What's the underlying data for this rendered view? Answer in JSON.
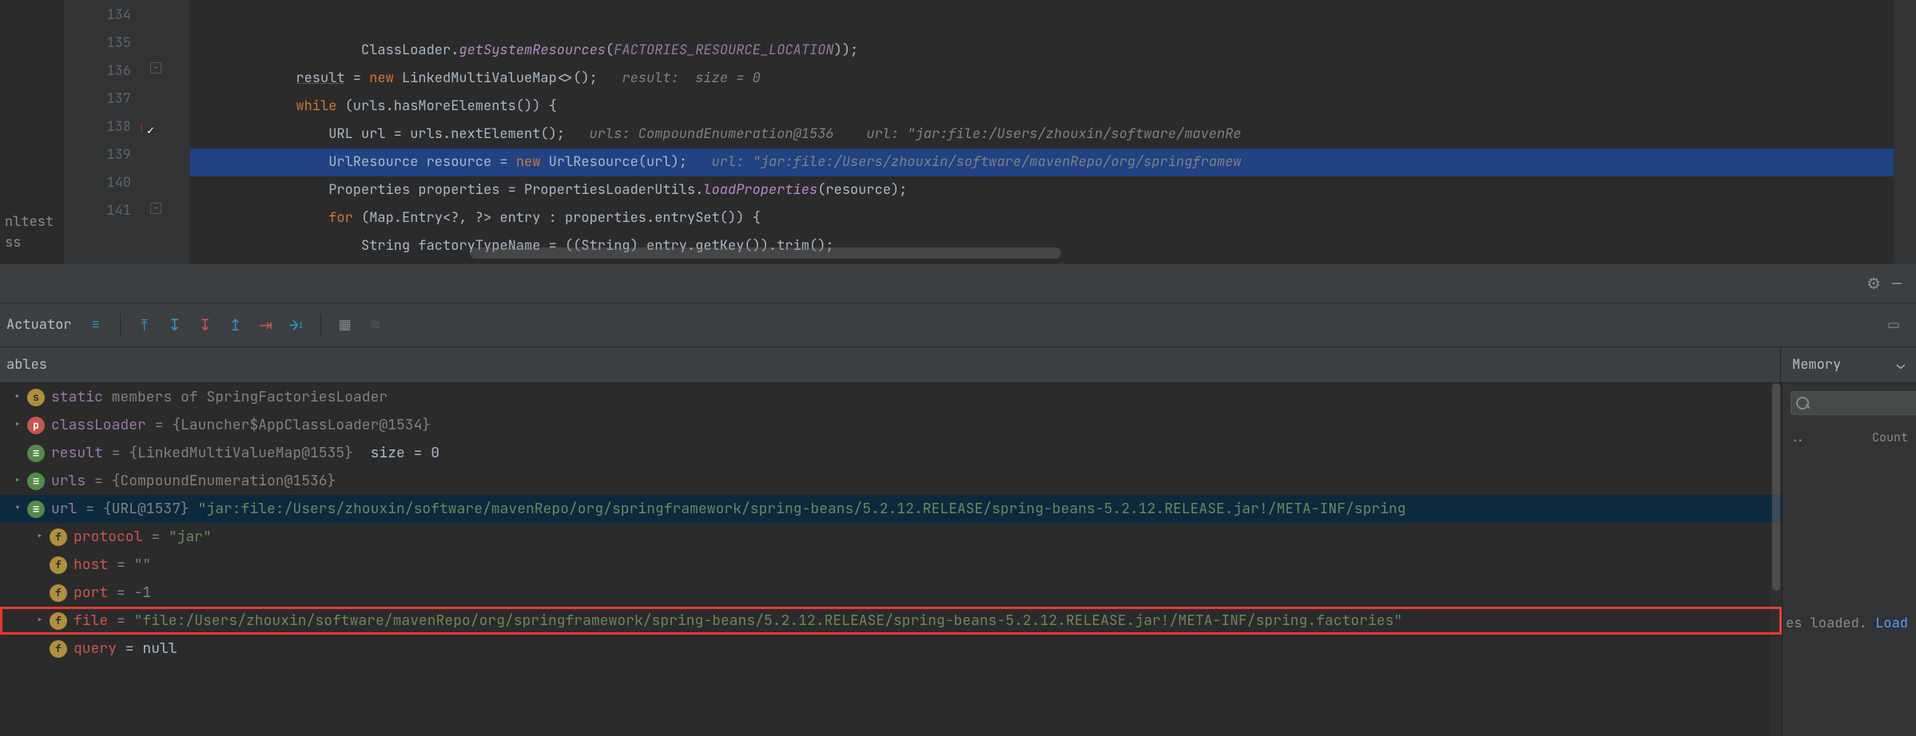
{
  "editor": {
    "left_cut": [
      "nltest",
      "ss"
    ],
    "lines": [
      {
        "n": 134,
        "html": "                    ClassLoader.<span class='static-m'>getSystemResources</span>(<span class='const'>FACTORIES_RESOURCE_LOCATION</span>));"
      },
      {
        "n": 135,
        "html": "            <span class='field-ref'>result</span> = <span class='kw'>new</span> LinkedMultiValueMap&lt;&gt;();   <span class='comment'>result:  size = 0</span>"
      },
      {
        "n": 136,
        "html": "            <span class='kw'>while</span> (urls.hasMoreElements()) {"
      },
      {
        "n": 137,
        "html": "                URL url = urls.nextElement();   <span class='comment'>urls: CompoundEnumeration@1536    url: \"jar:file:/Users/zhouxin/software/mavenRe</span>"
      },
      {
        "n": 138,
        "bp": true,
        "current": true,
        "html": "                UrlResource resource = <span class='kw'>new</span> UrlResource(url);   <span class='comment'>url: \"jar:file:/Users/zhouxin/software/mavenRepo/org/springframew</span>"
      },
      {
        "n": 139,
        "html": "                Properties properties = PropertiesLoaderUtils.<span class='static-m'>loadProperties</span>(resource);"
      },
      {
        "n": 140,
        "html": "                <span class='kw'>for</span> (Map.Entry&lt;?, ?&gt; entry : properties.entrySet()) {"
      },
      {
        "n": 141,
        "html": "                    String factoryTypeName = ((String) entry.getKey()).trim();"
      }
    ]
  },
  "toolbar": {
    "actuator": "Actuator"
  },
  "ables_label": "ables",
  "memory_tab": "Memory",
  "memory_panel": {
    "placeholder": "",
    "dots": "..",
    "count": "Count",
    "loaded_text": "es loaded. ",
    "load_link": "Load"
  },
  "vars": [
    {
      "ind": 0,
      "chev": "right",
      "badge": "s",
      "name": "static",
      "rest": " members of SpringFactoriesLoader",
      "grey_rest": true
    },
    {
      "ind": 0,
      "chev": "right",
      "badge": "p",
      "name": "classLoader",
      "val": " = {Launcher$AppClassLoader@1534}"
    },
    {
      "ind": 0,
      "chev": "none",
      "badge": "eq",
      "name": "result",
      "val": " = {LinkedMultiValueMap@1535} ",
      "extra": " size = 0"
    },
    {
      "ind": 0,
      "chev": "right",
      "badge": "eq",
      "name": "urls",
      "val": " = {CompoundEnumeration@1536}"
    },
    {
      "ind": 0,
      "chev": "down",
      "badge": "eq",
      "name": "url",
      "val": " = {URL@1537} ",
      "str": "\"jar:file:/Users/zhouxin/software/mavenRepo/org/springframework/spring-beans/5.2.12.RELEASE/spring-beans-5.2.12.RELEASE.jar!/META-INF/spring",
      "sel": true
    },
    {
      "ind": 1,
      "chev": "right",
      "badge": "f",
      "name": "protocol",
      "name_red": true,
      "val": " = ",
      "str": "\"jar\""
    },
    {
      "ind": 1,
      "chev": "none",
      "badge": "f",
      "name": "host",
      "name_red": true,
      "val": " = ",
      "str": "\"\""
    },
    {
      "ind": 1,
      "chev": "none",
      "badge": "f",
      "name": "port",
      "name_red": true,
      "val": " = -1"
    },
    {
      "ind": 1,
      "chev": "right",
      "badge": "f",
      "name": "file",
      "name_red": true,
      "val": " = ",
      "str": "\"file:/Users/zhouxin/software/mavenRepo/org/springframework/spring-beans/5.2.12.RELEASE/spring-beans-5.2.12.RELEASE.jar!/META-INF/spring.factories\"",
      "hl": true
    },
    {
      "ind": 1,
      "chev": "none",
      "badge": "f",
      "name": "query",
      "name_red": true,
      "val": " = null",
      "val_white": true
    }
  ]
}
